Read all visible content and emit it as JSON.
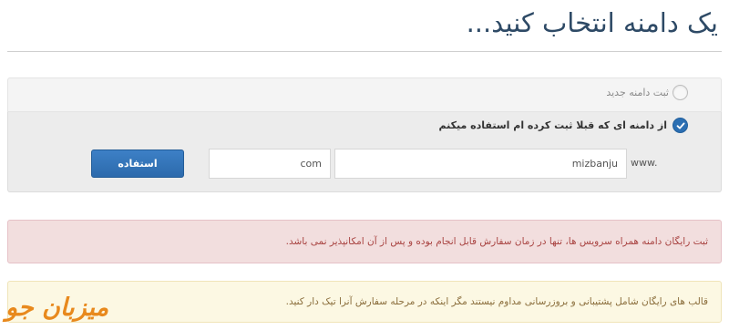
{
  "header": {
    "title": "یک دامنه انتخاب کنید..."
  },
  "options": {
    "new_domain": {
      "label": "ثبت دامنه جدید",
      "selected": false
    },
    "existing_domain": {
      "label": "از دامنه ای که قبلا ثبت کرده ام استفاده میکنم",
      "selected": true
    }
  },
  "domain_form": {
    "prefix": "www.",
    "domain_value": "mizbanju",
    "tld_value": "com",
    "submit_label": "استفاده"
  },
  "alerts": {
    "danger": "ثبت رایگان دامنه همراه سرویس ها، تنها در زمان سفارش قابل انجام بوده و پس از آن امکانپذیر نمی باشد.",
    "warning": "قالب های رایگان شامل پشتیبانی و بروزرسانی مداوم نیستند مگر اینکه در مرحله سفارش آنرا تیک دار کنید."
  },
  "watermark": {
    "text": "میزبان جو"
  },
  "colors": {
    "title": "#2e4a66",
    "accent": "#2b6fb3",
    "danger_bg": "#f2dede",
    "danger_text": "#a94442",
    "warning_bg": "#fcf8e3",
    "warning_text": "#8a6d3b",
    "logo": "#e8891d"
  },
  "icons": {
    "radio_checked": "check-icon"
  }
}
